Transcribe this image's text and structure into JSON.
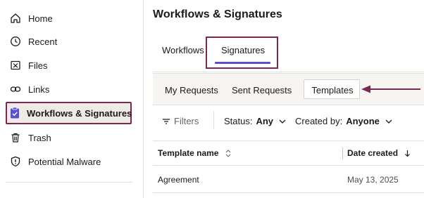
{
  "sidebar": {
    "items": [
      {
        "label": "Home",
        "icon": "home-icon",
        "active": false
      },
      {
        "label": "Recent",
        "icon": "clock-icon",
        "active": false
      },
      {
        "label": "Files",
        "icon": "folder-icon",
        "active": false
      },
      {
        "label": "Links",
        "icon": "link-icon",
        "active": false
      },
      {
        "label": "Workflows & Signatures",
        "icon": "clipboard-check-icon",
        "active": true
      },
      {
        "label": "Trash",
        "icon": "trash-icon",
        "active": false
      },
      {
        "label": "Potential Malware",
        "icon": "shield-alert-icon",
        "active": false
      }
    ]
  },
  "main": {
    "title": "Workflows & Signatures",
    "tabs": [
      {
        "label": "Workflows",
        "active": false
      },
      {
        "label": "Signatures",
        "active": true
      }
    ],
    "subtabs": [
      {
        "label": "My Requests",
        "active": false
      },
      {
        "label": "Sent Requests",
        "active": false
      },
      {
        "label": "Templates",
        "active": true
      }
    ],
    "filters": {
      "filters_label": "Filters",
      "status_label": "Status:",
      "status_value": "Any",
      "created_by_label": "Created by:",
      "created_by_value": "Anyone"
    },
    "table": {
      "columns": [
        "Template name",
        "Date created"
      ],
      "rows": [
        {
          "name": "Agreement",
          "date": "May 13, 2025"
        }
      ]
    }
  },
  "colors": {
    "highlight_border": "#7a2850",
    "active_tab_underline": "#5b4fd1",
    "active_nav_bg": "#eeeae6"
  }
}
